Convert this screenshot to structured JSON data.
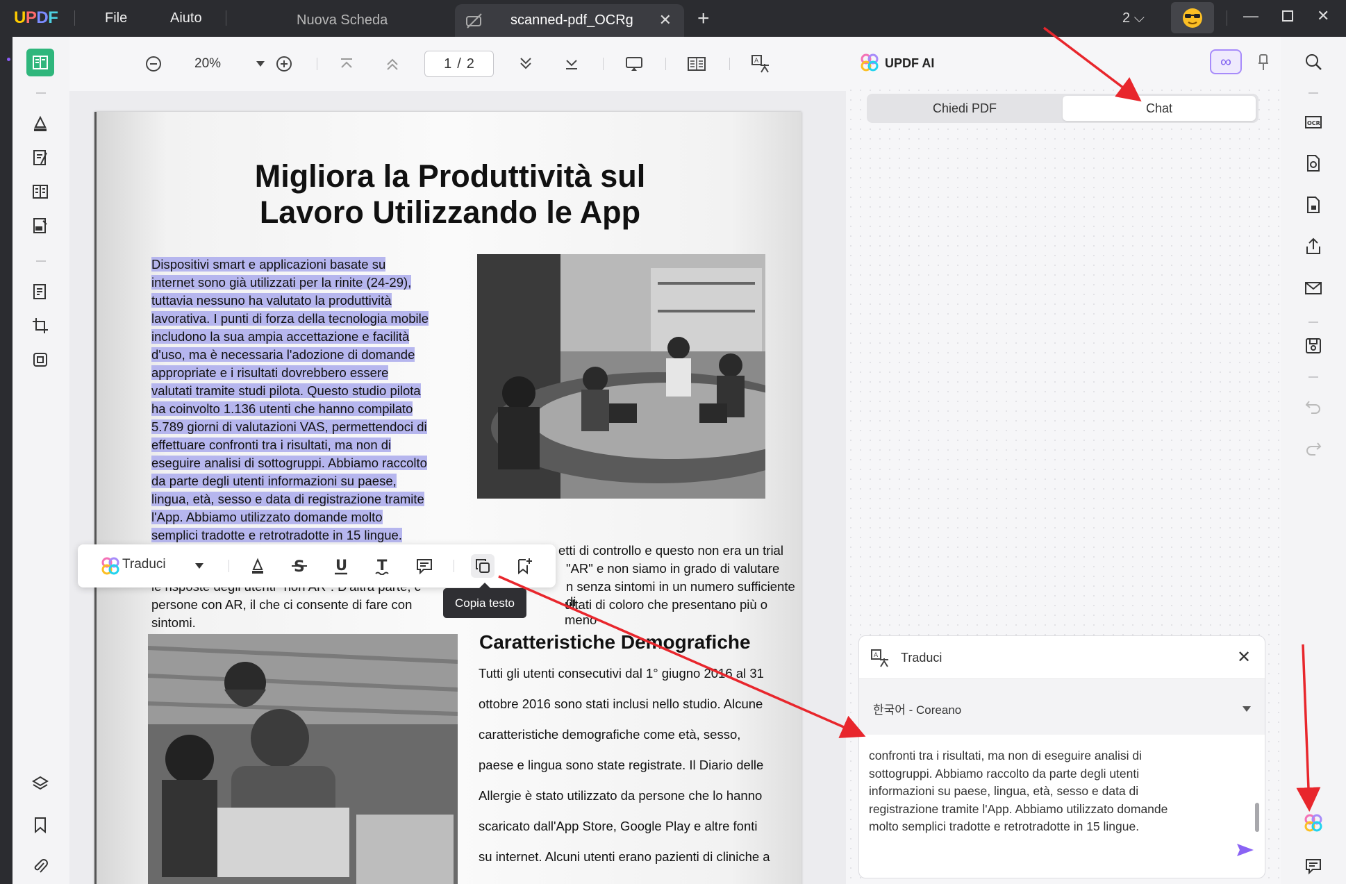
{
  "app": {
    "logo": "UPDF"
  },
  "menu": {
    "file": "File",
    "help": "Aiuto"
  },
  "tabs": [
    {
      "label": "Nuova Scheda"
    },
    {
      "label": "scanned-pdf_OCRg"
    }
  ],
  "window": {
    "count": "2"
  },
  "toolbar": {
    "zoom": "20%",
    "current_page": "1",
    "page_sep": "/",
    "total_pages": "2"
  },
  "document": {
    "title_line1": "Migliora la Produttività sul",
    "title_line2": "Lavoro Utilizzando le App",
    "selected_lines": [
      "Dispositivi smart e applicazioni basate su",
      "internet sono già utilizzati per la rinite (24-29),",
      "tuttavia nessuno ha valutato la produttività",
      "lavorativa. I punti di forza della tecnologia mobile",
      "includono la sua ampia accettazione e facilità",
      "d'uso, ma è necessaria l'adozione di domande",
      "appropriate e i risultati dovrebbero essere",
      "valutati tramite studi pilota. Questo studio pilota",
      "ha coinvolto 1.136 utenti che hanno compilato",
      "5.789 giorni di valutazioni VAS, permettendoci di",
      "effettuare confronti tra i risultati, ma non di",
      "eseguire analisi di sottogruppi. Abbiamo raccolto",
      "da parte degli utenti informazioni su paese,",
      "lingua, età, sesso e data di registrazione tramite",
      "l'App. Abbiamo utilizzato domande molto",
      "semplici tradotte e retrotradotte in 15 lingue."
    ],
    "partial_line1": "etti di controllo e questo non era un trial",
    "partial_line2": "\"AR\" e non siamo in grado di valutare",
    "partial_line3a": "le risposte degli utenti \"non AR\". D'altra parte, c",
    "partial_line3b": "n senza sintomi in un numero sufficiente di",
    "partial_line4a": "persone con AR, il che ci consente di fare con",
    "partial_line4b": "ultati di coloro che presentano più o meno",
    "partial_line5": "sintomi.",
    "section_title": "Caratteristiche Demografiche",
    "demo_lines": [
      "Tutti gli utenti consecutivi dal 1° giugno 2016 al 31",
      "ottobre 2016 sono stati inclusi nello studio. Alcune",
      "caratteristiche demografiche come età, sesso,",
      "paese e lingua sono state registrate. Il Diario delle",
      "Allergie è stato utilizzato da persone che lo hanno",
      "scaricato dall'App Store, Google Play e altre fonti",
      "su internet. Alcuni utenti erano pazienti di cliniche a"
    ]
  },
  "selection_toolbar": {
    "translate_label": "Traduci",
    "tooltip": "Copia testo"
  },
  "ai_panel": {
    "title": "UPDF AI",
    "tab_ask": "Chiedi PDF",
    "tab_chat": "Chat",
    "translate_title": "Traduci",
    "language": "한국어 - Coreano",
    "translate_lines": [
      "confronti tra i risultati, ma non di eseguire analisi di",
      "sottogruppi. Abbiamo raccolto da parte degli utenti",
      "informazioni su paese, lingua, età, sesso e data di",
      "registrazione tramite l'App. Abbiamo utilizzato domande",
      "molto semplici tradotte e retrotradotte in 15 lingue."
    ]
  },
  "colors": {
    "accent": "#7c5cf0",
    "highlight": "#b6b6ee",
    "arrow": "#e8262c",
    "send": "#8a63f4"
  }
}
